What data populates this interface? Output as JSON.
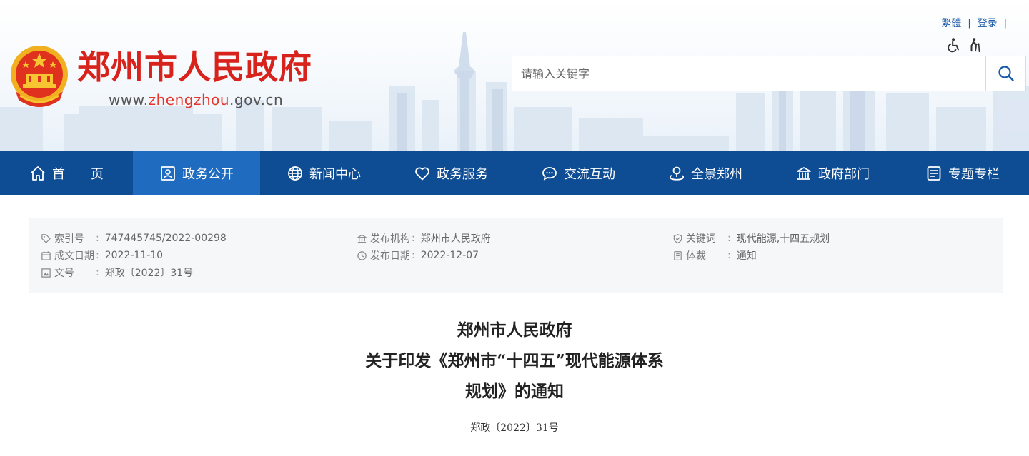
{
  "header": {
    "site_title": "郑州市人民政府",
    "url_prefix": "www.",
    "url_accent": "zhengzhou",
    "url_suffix": ".gov.cn",
    "top_links": [
      "繁體",
      "登录"
    ],
    "search_placeholder": "请输入关键字"
  },
  "nav": {
    "items": [
      {
        "label": "首　　页",
        "icon": "home-icon"
      },
      {
        "label": "政务公开",
        "icon": "id-card-icon",
        "active": true
      },
      {
        "label": "新闻中心",
        "icon": "globe-icon"
      },
      {
        "label": "政务服务",
        "icon": "heart-icon"
      },
      {
        "label": "交流互动",
        "icon": "chat-icon"
      },
      {
        "label": "全景郑州",
        "icon": "panorama-icon"
      },
      {
        "label": "政府部门",
        "icon": "building-icon"
      },
      {
        "label": "专题专栏",
        "icon": "columns-icon"
      }
    ]
  },
  "meta": {
    "index_label": "索引号",
    "index_value": "747445745/2022-00298",
    "created_label": "成文日期",
    "created_value": "2022-11-10",
    "docno_label": "文号",
    "docno_value": "郑政〔2022〕31号",
    "issuer_label": "发布机构",
    "issuer_value": "郑州市人民政府",
    "published_label": "发布日期",
    "published_value": "2022-12-07",
    "keywords_label": "关键词",
    "keywords_value": "现代能源,十四五规划",
    "genre_label": "体裁",
    "genre_value": "通知"
  },
  "document": {
    "title_line1": "郑州市人民政府",
    "title_line2": "关于印发《郑州市“十四五”现代能源体系",
    "title_line3": "规划》的通知",
    "number": "郑政〔2022〕31号"
  },
  "colors": {
    "brand_red": "#d7231b",
    "nav_blue": "#0e4d94",
    "nav_active": "#1f6bbf"
  }
}
